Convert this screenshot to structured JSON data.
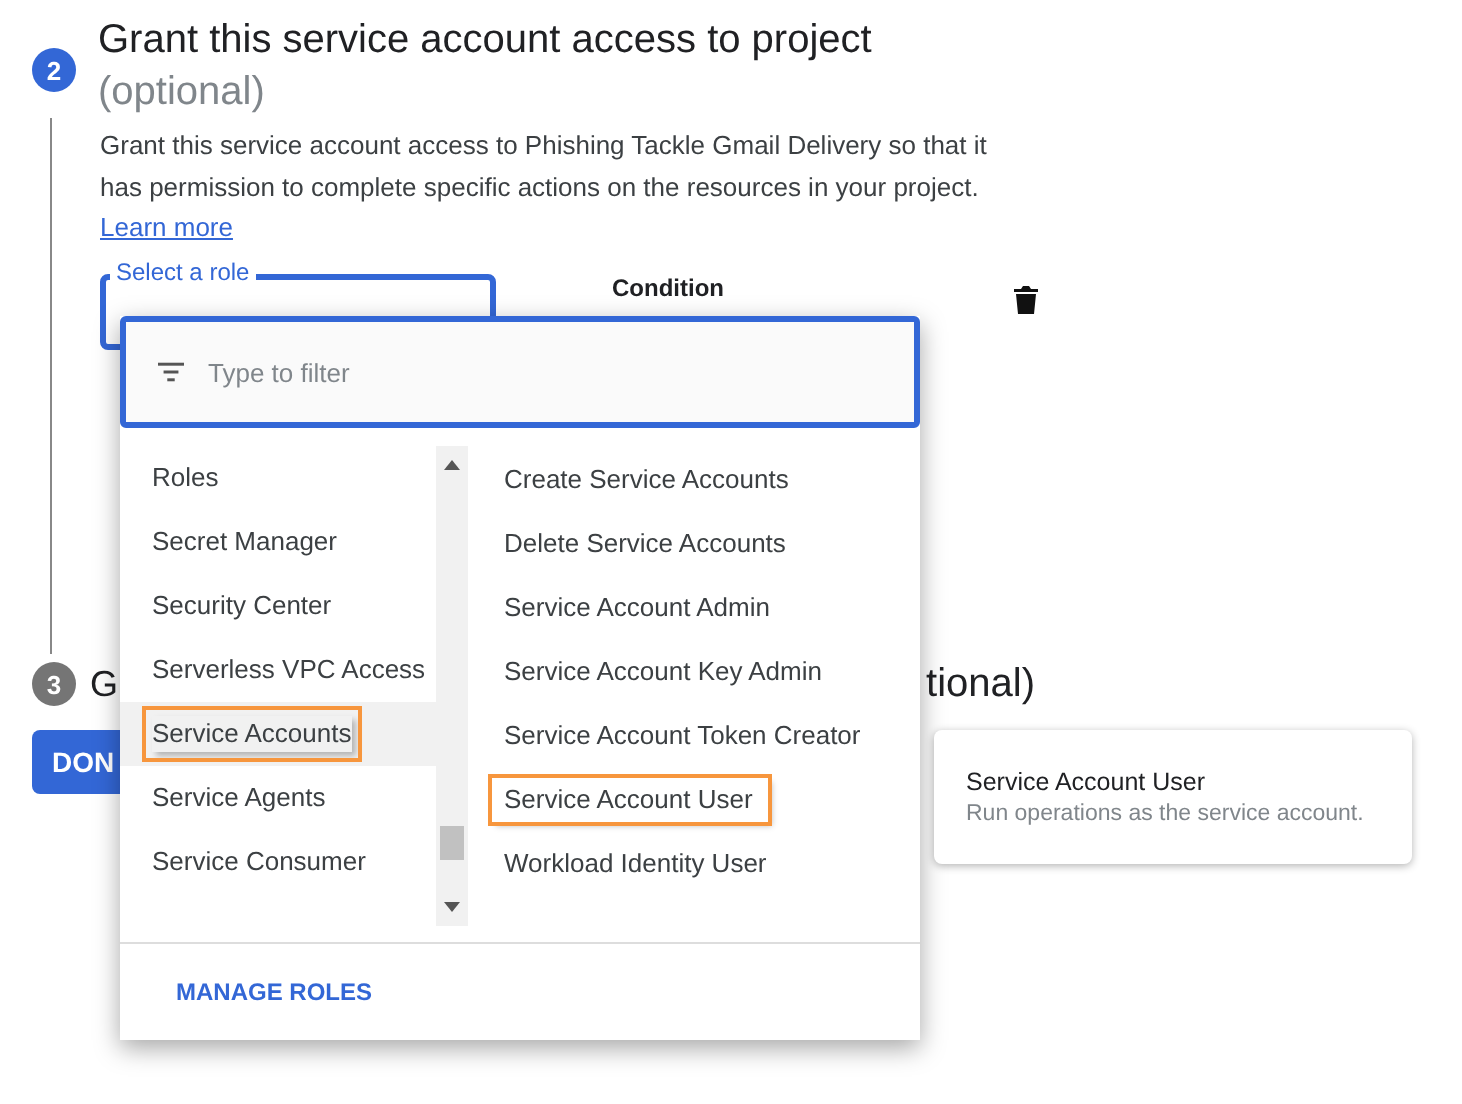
{
  "step2": {
    "number": "2",
    "title": "Grant this service account access to project",
    "subtitle": "(optional)",
    "description": "Grant this service account access to Phishing Tackle Gmail Delivery so that it has permission to complete specific actions on the resources in your project.",
    "link": "Learn more",
    "role_field": {
      "label": "Select a role"
    },
    "condition_label": "Condition"
  },
  "step3": {
    "number": "3",
    "title_start": "G",
    "title_end": "tional)"
  },
  "done_button": "DON",
  "role_menu": {
    "filter": {
      "placeholder": "Type to filter"
    },
    "categories": [
      {
        "label": "Roles",
        "selected": false,
        "highlighted": false
      },
      {
        "label": "Secret Manager",
        "selected": false,
        "highlighted": false
      },
      {
        "label": "Security Center",
        "selected": false,
        "highlighted": false
      },
      {
        "label": "Serverless VPC Access",
        "selected": false,
        "highlighted": false
      },
      {
        "label": "Service Accounts",
        "selected": true,
        "highlighted": true
      },
      {
        "label": "Service Agents",
        "selected": false,
        "highlighted": false
      },
      {
        "label": "Service Consumer",
        "selected": false,
        "highlighted": false
      }
    ],
    "roles": [
      {
        "label": "Create Service Accounts",
        "highlighted": false
      },
      {
        "label": "Delete Service Accounts",
        "highlighted": false
      },
      {
        "label": "Service Account Admin",
        "highlighted": false
      },
      {
        "label": "Service Account Key Admin",
        "highlighted": false
      },
      {
        "label": "Service Account Token Creator",
        "highlighted": false
      },
      {
        "label": "Service Account User",
        "highlighted": true
      },
      {
        "label": "Workload Identity User",
        "highlighted": false
      }
    ],
    "manage_button": "MANAGE ROLES"
  },
  "tooltip": {
    "title": "Service Account User",
    "text": "Run operations as the service account."
  }
}
